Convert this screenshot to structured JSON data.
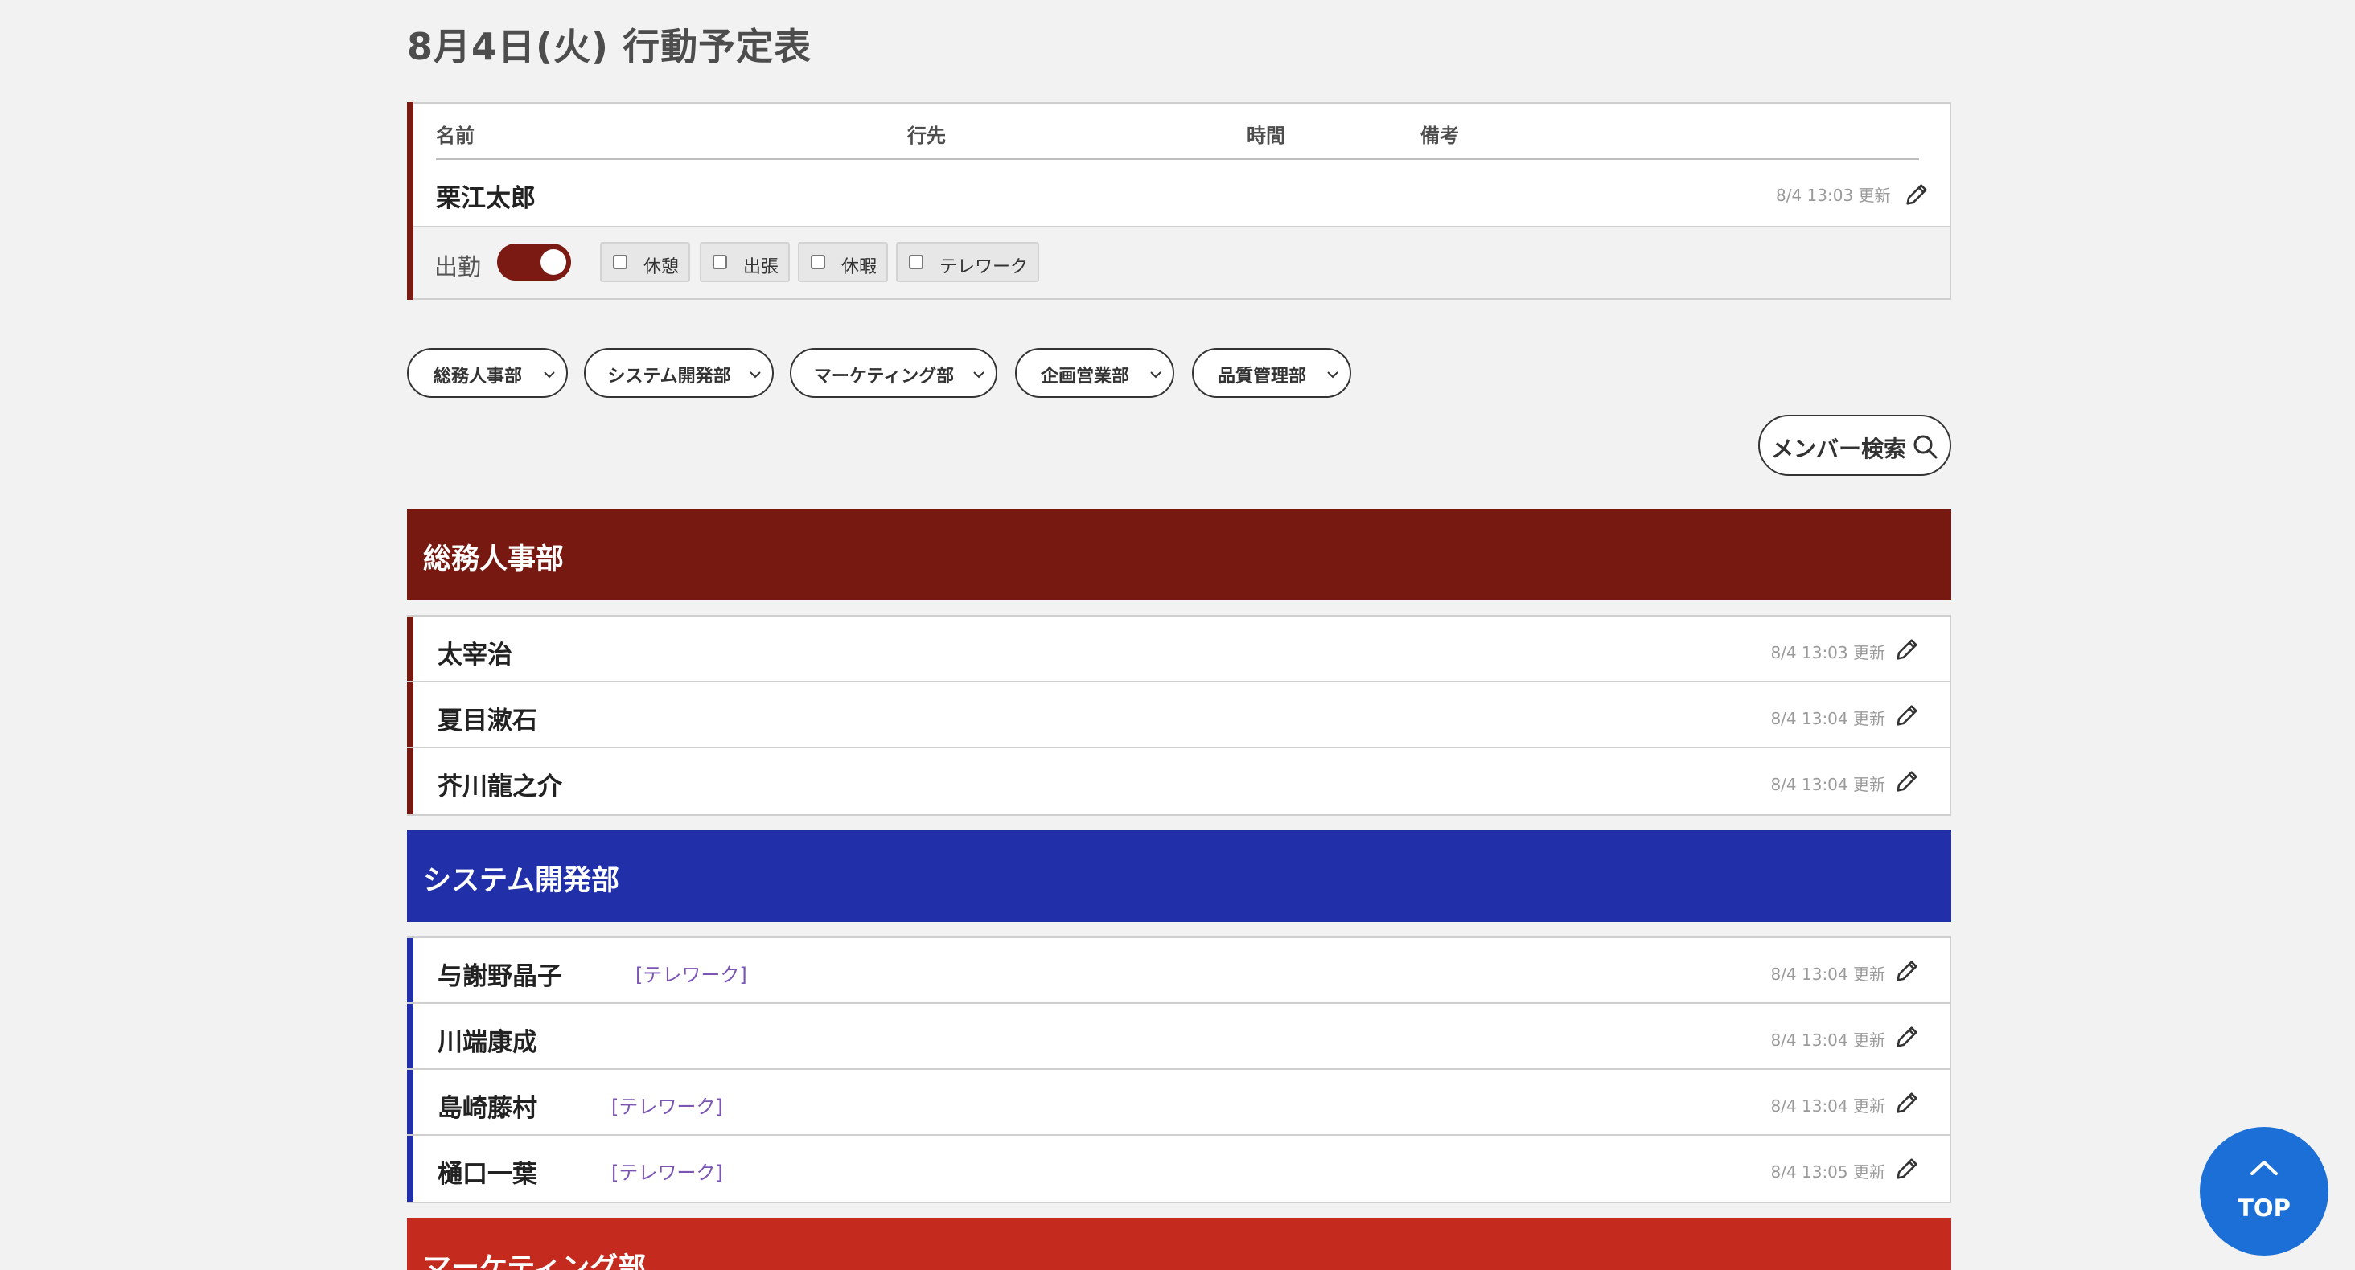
{
  "page": {
    "title": "8月4日(火) 行動予定表"
  },
  "self_card": {
    "headers": [
      "名前",
      "行先",
      "時間",
      "備考"
    ],
    "name": "栗江太郎",
    "updated": "8/4 13:03 更新",
    "attendance_label": "出勤",
    "attendance_on": true,
    "checkboxes": [
      {
        "label": "休憩",
        "checked": false
      },
      {
        "label": "出張",
        "checked": false
      },
      {
        "label": "休暇",
        "checked": false
      },
      {
        "label": "テレワーク",
        "checked": false
      }
    ]
  },
  "filters": {
    "departments": [
      "総務人事部",
      "システム開発部",
      "マーケティング部",
      "企画営業部",
      "品質管理部"
    ],
    "search_label": "メンバー検索"
  },
  "departments": [
    {
      "name": "総務人事部",
      "color": "#771911",
      "members": [
        {
          "name": "太宰治",
          "tag": "",
          "updated": "8/4 13:03 更新"
        },
        {
          "name": "夏目漱石",
          "tag": "",
          "updated": "8/4 13:04 更新"
        },
        {
          "name": "芥川龍之介",
          "tag": "",
          "updated": "8/4 13:04 更新"
        }
      ]
    },
    {
      "name": "システム開発部",
      "color": "#212fa8",
      "members": [
        {
          "name": "与謝野晶子",
          "tag": "[テレワーク]",
          "updated": "8/4 13:04 更新"
        },
        {
          "name": "川端康成",
          "tag": "",
          "updated": "8/4 13:04 更新"
        },
        {
          "name": "島崎藤村",
          "tag": "[テレワーク]",
          "updated": "8/4 13:04 更新"
        },
        {
          "name": "樋口一葉",
          "tag": "[テレワーク]",
          "updated": "8/4 13:05 更新"
        }
      ]
    },
    {
      "name": "マーケティング部",
      "color": "#c52a1e",
      "members": []
    }
  ],
  "top_button": {
    "label": "TOP"
  },
  "colors": {
    "accent_dark_red": "#7a1a13",
    "blue": "#212fa8",
    "red": "#c52a1e",
    "tag_purple": "#7b55b3",
    "top_button": "#1c6fd6"
  },
  "icons": [
    "pencil-icon",
    "chevron-down-icon",
    "search-icon",
    "chevron-up-icon"
  ]
}
